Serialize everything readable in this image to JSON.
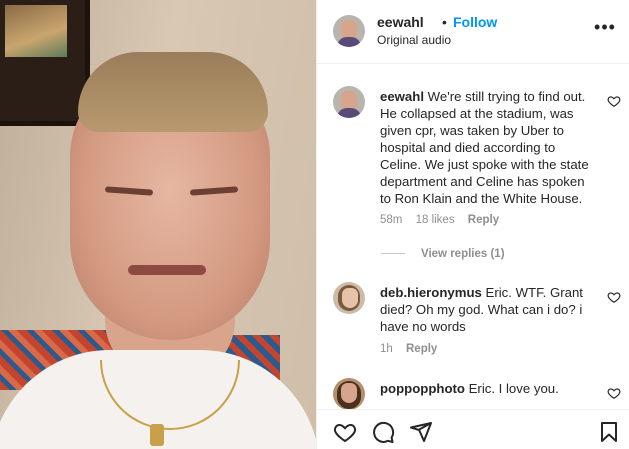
{
  "header": {
    "username": "eewahl",
    "separator": "•",
    "follow_label": "Follow",
    "audio_label": "Original audio",
    "more_label": "•••"
  },
  "comments": [
    {
      "username": "eewahl",
      "text": "We're still trying to find out. He collapsed at the stadium, was given cpr, was taken by Uber to hospital and died according to Celine. We just spoke with the state department and Celine has spoken to Ron Klain and the White House.",
      "time": "58m",
      "likes": "18 likes",
      "reply_label": "Reply",
      "view_replies": "View replies (1)"
    },
    {
      "username": "deb.hieronymus",
      "text": "Eric. WTF. Grant died? Oh my god. What can i do? i have no words",
      "time": "1h",
      "reply_label": "Reply"
    },
    {
      "username": "poppopphoto",
      "text": "Eric. I love you."
    }
  ],
  "icons": {
    "like": "heart-icon",
    "comment": "comment-icon",
    "share": "share-icon",
    "save": "bookmark-icon"
  },
  "colors": {
    "follow": "#0095f6",
    "muted": "#8e8e8e",
    "text": "#262626"
  }
}
